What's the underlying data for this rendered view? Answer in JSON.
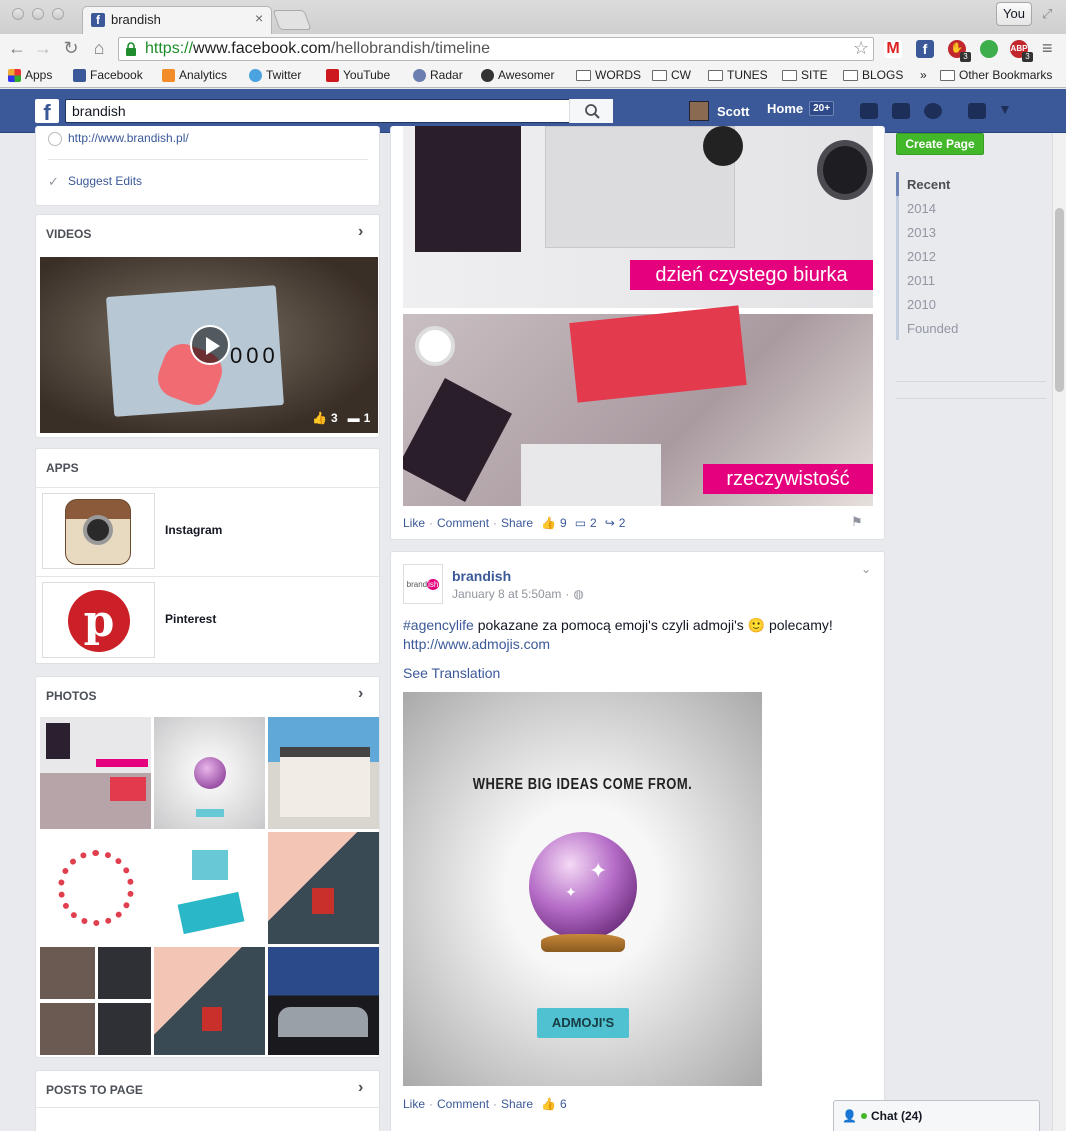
{
  "browser": {
    "tab_title": "brandish",
    "profile_button": "You",
    "url": {
      "scheme": "https://",
      "domain": "www.facebook.com",
      "path": "/hellobrandish/timeline"
    },
    "bookmarks": [
      {
        "label": "Apps",
        "icon": "apps-grid-icon"
      },
      {
        "label": "Facebook",
        "icon": "facebook-icon"
      },
      {
        "label": "Analytics",
        "icon": "analytics-icon"
      },
      {
        "label": "Twitter",
        "icon": "twitter-bird-icon"
      },
      {
        "label": "YouTube",
        "icon": "youtube-icon"
      },
      {
        "label": "Radar",
        "icon": "radar-icon"
      },
      {
        "label": "Awesomer",
        "icon": "awesomer-icon"
      },
      {
        "label": "WORDS",
        "icon": "folder-icon"
      },
      {
        "label": "CW",
        "icon": "folder-icon"
      },
      {
        "label": "TUNES",
        "icon": "folder-icon"
      },
      {
        "label": "SITE",
        "icon": "folder-icon"
      },
      {
        "label": "BLOGS",
        "icon": "folder-icon"
      }
    ],
    "bookmarks_overflow": "»",
    "other_bookmarks": "Other Bookmarks",
    "extension_badges": {
      "adblock": "3",
      "abp": "3"
    }
  },
  "facebook": {
    "search_value": "brandish",
    "user_name": "Scott",
    "home_label": "Home",
    "home_count": "20+"
  },
  "left_col": {
    "website": "http://www.brandish.pl/",
    "suggest_edits": "Suggest Edits",
    "videos_title": "VIDEOS",
    "video_likes": "3",
    "video_comments": "1",
    "apps_title": "APPS",
    "apps": [
      {
        "name": "Instagram"
      },
      {
        "name": "Pinterest"
      }
    ],
    "photos_title": "PHOTOS",
    "posts_to_page_title": "POSTS TO PAGE"
  },
  "post1": {
    "image_caption_top": "dzień czystego biurka",
    "image_caption_bottom": "rzeczywistość",
    "like": "Like",
    "comment": "Comment",
    "share": "Share",
    "likes_count": "9",
    "comments_count": "2",
    "shares_count": "2"
  },
  "post2": {
    "author": "brandish",
    "timestamp": "January 8 at 5:50am",
    "hashtag": "#agencylife",
    "text": " pokazane za pomocą emoji's czyli admoji's ",
    "emoji": "🙂",
    "text_end": " polecamy!",
    "link": "http://www.admojis.com",
    "see_translation": "See Translation",
    "image_heading": "WHERE BIG IDEAS COME FROM.",
    "image_banner": "ADMOJI'S",
    "like": "Like",
    "comment": "Comment",
    "share": "Share",
    "likes_count": "6"
  },
  "right_col": {
    "create_page": "Create Page",
    "timeline_years": [
      "Recent",
      "2014",
      "2013",
      "2012",
      "2011",
      "2010",
      "Founded"
    ]
  },
  "chat": {
    "label": "Chat (24)"
  },
  "colors": {
    "fb_blue": "#3b5998",
    "green_button": "#42b72a",
    "pink_caption": "#e5007e"
  }
}
